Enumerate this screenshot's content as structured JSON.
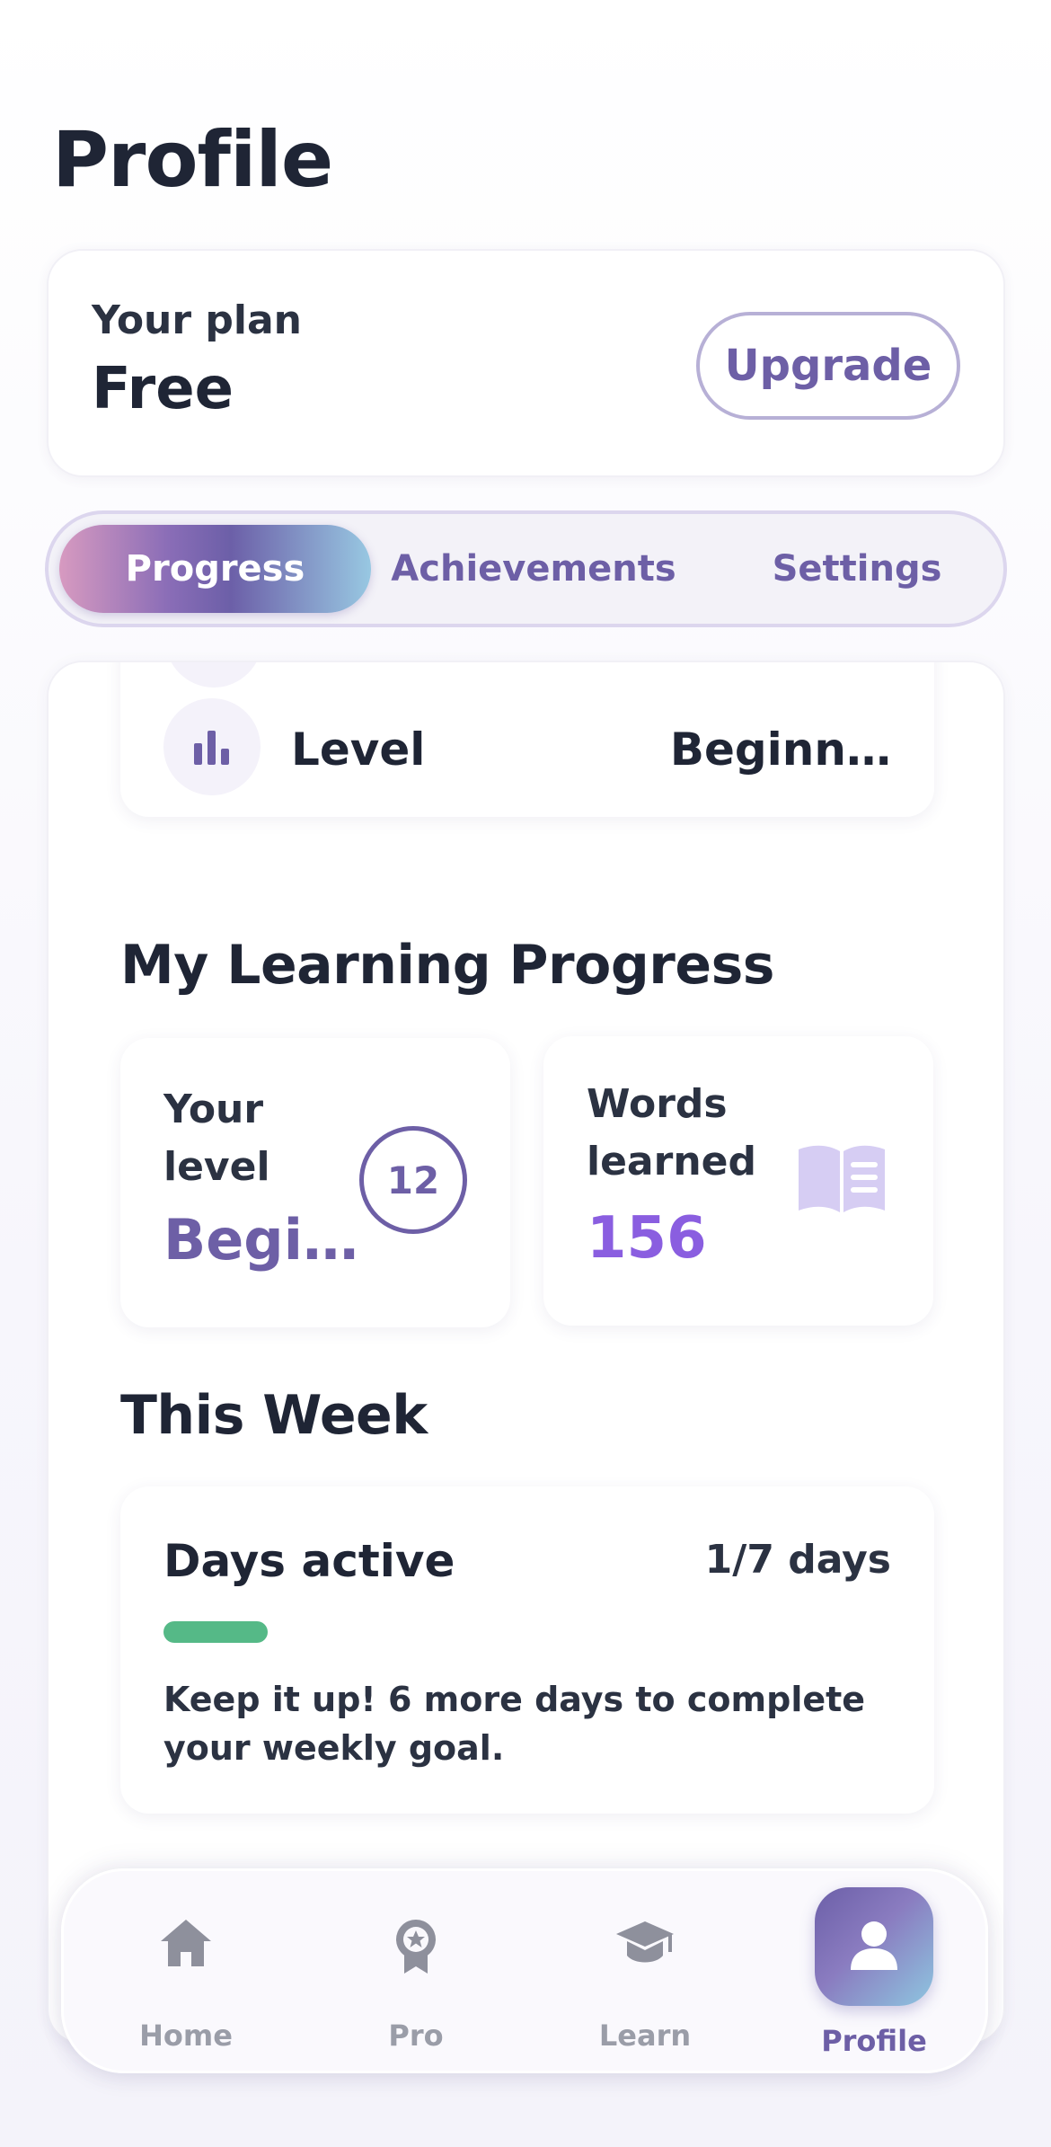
{
  "header": {
    "title": "Profile"
  },
  "plan": {
    "label": "Your plan",
    "value": "Free",
    "upgrade_label": "Upgrade"
  },
  "tabs": [
    {
      "label": "Progress",
      "active": true
    },
    {
      "label": "Achievements",
      "active": false
    },
    {
      "label": "Settings",
      "active": false
    }
  ],
  "level_row": {
    "label": "Level",
    "value": "Beginn…",
    "icon": "bar-chart-icon"
  },
  "learning": {
    "title": "My Learning Progress",
    "level_card": {
      "label": "Your level",
      "value": "Begi…",
      "number": "12"
    },
    "words_card": {
      "label": "Words learned",
      "value": "156",
      "icon": "book-icon"
    }
  },
  "week": {
    "title": "This Week",
    "days_label": "Days active",
    "days_count": "1/7 days",
    "progress_fraction": 0.142857,
    "message": "Keep it up! 6 more days to complete your weekly goal."
  },
  "nav": [
    {
      "label": "Home",
      "icon": "home-icon",
      "active": false
    },
    {
      "label": "Pro",
      "icon": "award-icon",
      "active": false
    },
    {
      "label": "Learn",
      "icon": "graduation-cap-icon",
      "active": false
    },
    {
      "label": "Profile",
      "icon": "user-icon",
      "active": true
    }
  ],
  "colors": {
    "accent": "#6d5fa6",
    "accent_bright": "#8a5ee0",
    "progress": "#55b987",
    "text_dark": "#1f2535",
    "nav_inactive": "#9a9da8"
  }
}
